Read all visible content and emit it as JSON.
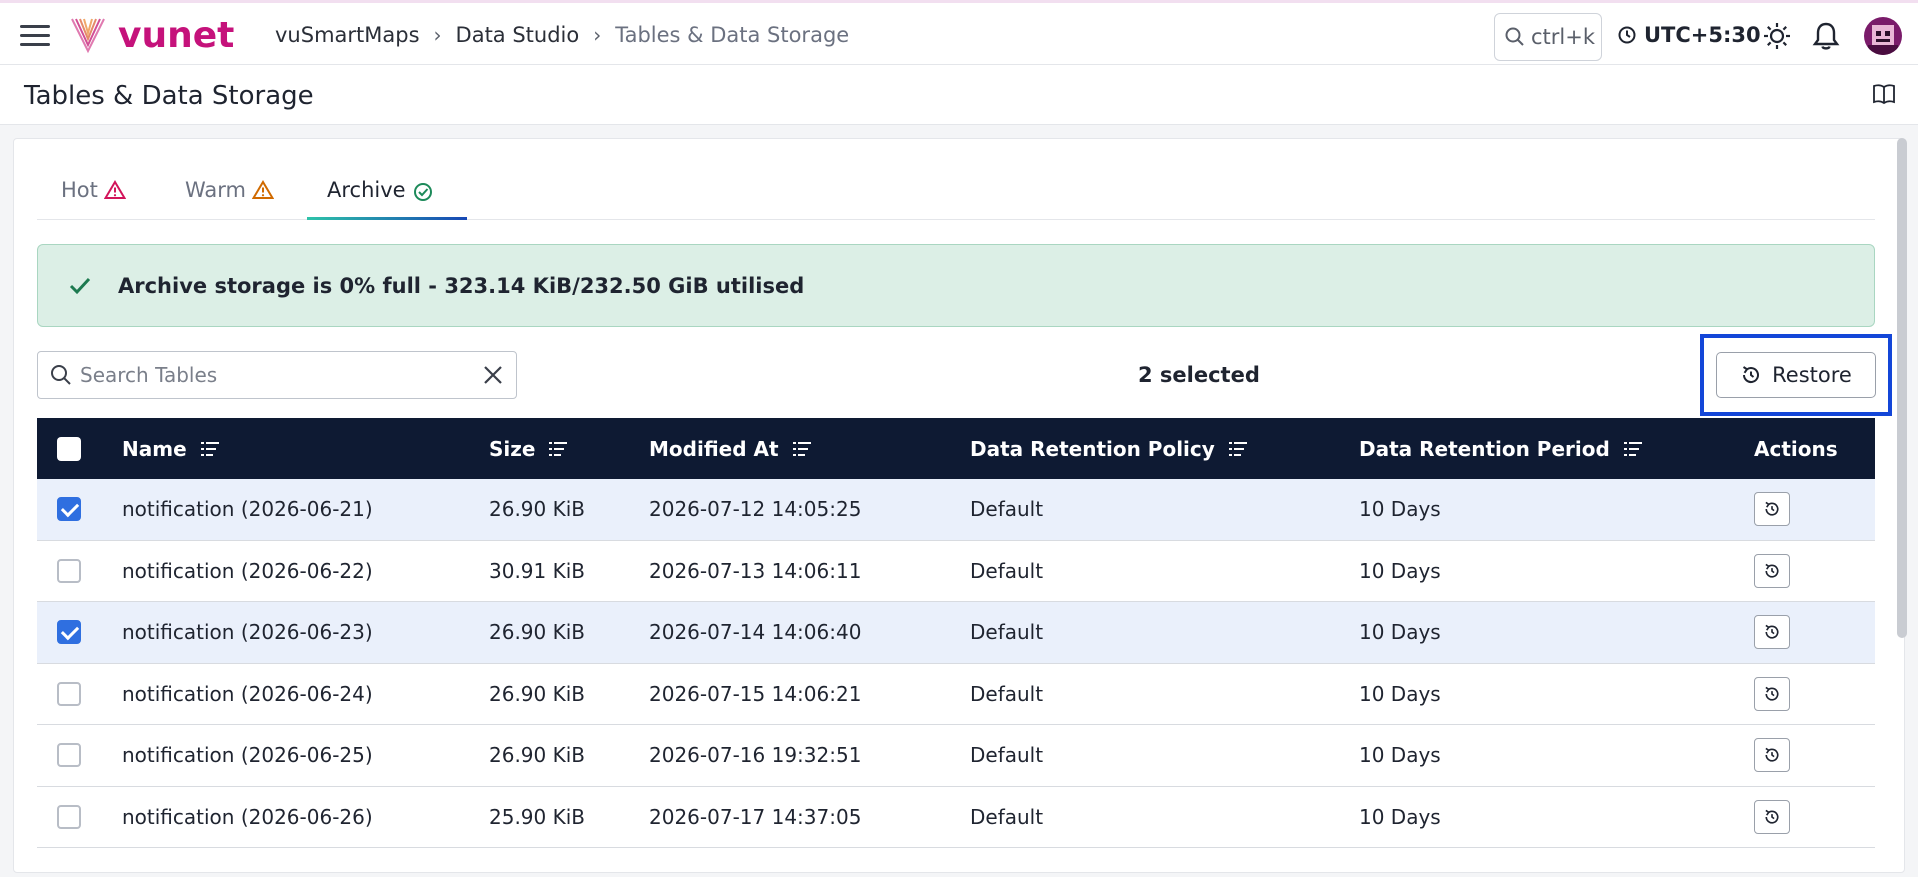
{
  "header": {
    "logo_text": "vunet",
    "breadcrumbs": [
      "vuSmartMaps",
      "Data Studio",
      "Tables & Data Storage"
    ],
    "search_shortcut": "ctrl+k",
    "timezone": "UTC+5:30"
  },
  "page": {
    "title": "Tables & Data Storage"
  },
  "tabs": [
    {
      "label": "Hot",
      "icon": "warning-icon",
      "color": "#d2145a"
    },
    {
      "label": "Warm",
      "icon": "warning-icon",
      "color": "#d06a00"
    },
    {
      "label": "Archive",
      "icon": "check-circle-icon",
      "color": "#1d8a5a",
      "active": true
    }
  ],
  "alert": {
    "text": "Archive storage is 0% full - 323.14 KiB/232.50 GiB utilised",
    "color": "#1d7a50"
  },
  "toolbar": {
    "search_placeholder": "Search Tables",
    "selected_text": "2 selected",
    "restore_label": "Restore"
  },
  "table": {
    "columns": [
      "Name",
      "Size",
      "Modified At",
      "Data Retention Policy",
      "Data Retention Period",
      "Actions"
    ],
    "rows": [
      {
        "name": "notification (2026-06-21)",
        "size": "26.90 KiB",
        "modified": "2026-07-12 14:05:25",
        "policy": "Default",
        "period": "10 Days",
        "checked": true
      },
      {
        "name": "notification (2026-06-22)",
        "size": "30.91 KiB",
        "modified": "2026-07-13 14:06:11",
        "policy": "Default",
        "period": "10 Days",
        "checked": false
      },
      {
        "name": "notification (2026-06-23)",
        "size": "26.90 KiB",
        "modified": "2026-07-14 14:06:40",
        "policy": "Default",
        "period": "10 Days",
        "checked": true
      },
      {
        "name": "notification (2026-06-24)",
        "size": "26.90 KiB",
        "modified": "2026-07-15 14:06:21",
        "policy": "Default",
        "period": "10 Days",
        "checked": false
      },
      {
        "name": "notification (2026-06-25)",
        "size": "26.90 KiB",
        "modified": "2026-07-16 19:32:51",
        "policy": "Default",
        "period": "10 Days",
        "checked": false
      },
      {
        "name": "notification (2026-06-26)",
        "size": "25.90 KiB",
        "modified": "2026-07-17 14:37:05",
        "policy": "Default",
        "period": "10 Days",
        "checked": false
      }
    ]
  }
}
